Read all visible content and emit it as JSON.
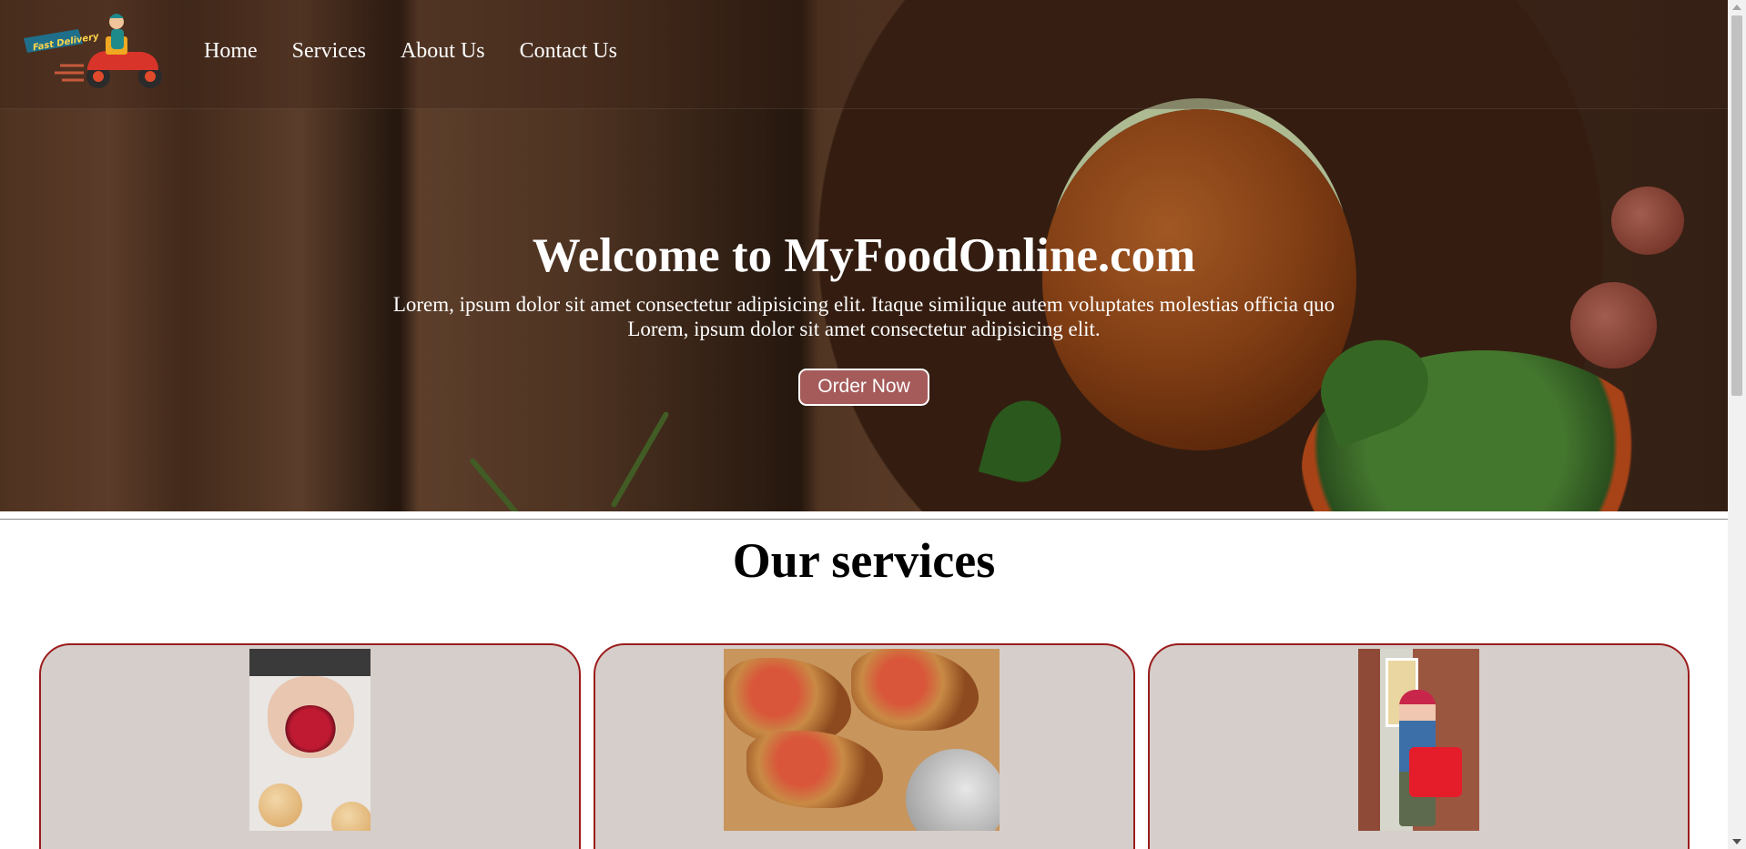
{
  "nav": {
    "logo_text": "Fast Delivery",
    "links": [
      {
        "label": "Home"
      },
      {
        "label": "Services"
      },
      {
        "label": "About Us"
      },
      {
        "label": "Contact Us"
      }
    ]
  },
  "hero": {
    "title": "Welcome to MyFoodOnline.com",
    "text": "Lorem, ipsum dolor sit amet consectetur adipisicing elit. Itaque similique autem voluptates molestias officia quo Lorem, ipsum dolor sit amet consectetur adipisicing elit.",
    "button_label": "Order Now"
  },
  "services": {
    "title": "Our services"
  },
  "colors": {
    "button_bg": "#a65b5b",
    "card_bg": "#d6ceca",
    "card_border": "#9b1c1c"
  },
  "icons": {
    "logo": "delivery-scooter-icon"
  }
}
